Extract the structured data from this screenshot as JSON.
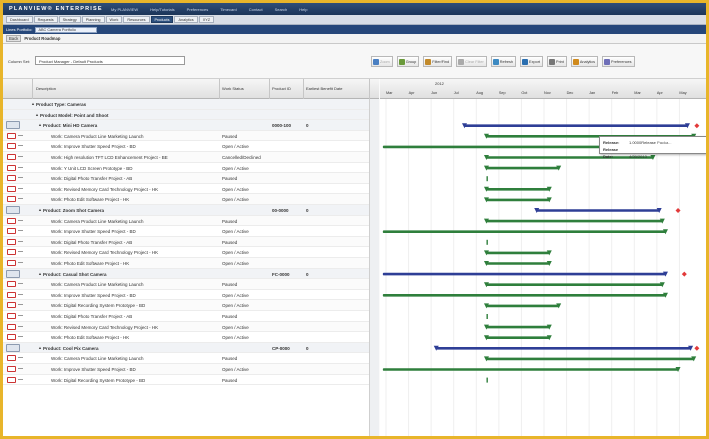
{
  "app": {
    "logo": "PLANVIEW® ENTERPRISE",
    "top_links": [
      "My PLANVIEW",
      "Help/Tutorials",
      "Preferences",
      "Timecard",
      "Contact",
      "Search",
      "Help"
    ]
  },
  "nav": [
    "Dashboard",
    "Requests",
    "Strategy",
    "Planning",
    "Work",
    "Resources",
    "Products",
    "Analytics",
    "XYZ"
  ],
  "nav_active": "Products",
  "portfolio": {
    "label": "Lines Portfolio:",
    "value": "ABC Camera Portfolio"
  },
  "breadcrumb": {
    "back": "Back",
    "title": "Product Roadmap"
  },
  "toolbar": {
    "column_set_label": "Column Set:",
    "column_set_value": "Product Manager - Default Products",
    "buttons": [
      "Zoom",
      "Group",
      "Filter/Find",
      "Clear Filter",
      "Refresh",
      "Export",
      "Print",
      "Analytics",
      "Preferences"
    ]
  },
  "grid": {
    "headers": [
      "Description",
      "Work Status",
      "Product ID",
      "Earliest Benefit Date"
    ],
    "rows": [
      {
        "type": "product-type",
        "desc": "Product Type: Cameras",
        "status": "",
        "pid": "",
        "date": ""
      },
      {
        "type": "model",
        "desc": "Product Model: Point and Shoot",
        "status": "",
        "pid": "",
        "date": ""
      },
      {
        "type": "product",
        "desc": "Product: Mini HD Camera",
        "status": "",
        "pid": "0000-100",
        "date": "0"
      },
      {
        "type": "work",
        "desc": "Work: Camera Product Line Marketing Launch",
        "status": "Paused",
        "pid": "",
        "date": ""
      },
      {
        "type": "work",
        "desc": "Work: Improve Shutter Speed Project - BD",
        "status": "Open / Active",
        "pid": "",
        "date": ""
      },
      {
        "type": "work",
        "desc": "Work: High resolution TFT LCD Enhancement Project - BE",
        "status": "Cancelled/Declined",
        "pid": "",
        "date": ""
      },
      {
        "type": "work",
        "desc": "Work: Y Unit LCD Screen Prototype - BD",
        "status": "Open / Active",
        "pid": "",
        "date": ""
      },
      {
        "type": "work",
        "desc": "Work: Digital Photo Transfer Project - AB",
        "status": "Paused",
        "pid": "",
        "date": ""
      },
      {
        "type": "work",
        "desc": "Work: Revised Memory Card Technology Project - HK",
        "status": "Open / Active",
        "pid": "",
        "date": ""
      },
      {
        "type": "work",
        "desc": "Work: Photo Edit Software Project - HK",
        "status": "Open / Active",
        "pid": "",
        "date": ""
      },
      {
        "type": "product",
        "desc": "Product: Zoom Shot Camera",
        "status": "",
        "pid": "00-0000",
        "date": "0"
      },
      {
        "type": "work",
        "desc": "Work: Camera Product Line Marketing Launch",
        "status": "Paused",
        "pid": "",
        "date": ""
      },
      {
        "type": "work",
        "desc": "Work: Improve Shutter Speed Project - BD",
        "status": "Open / Active",
        "pid": "",
        "date": ""
      },
      {
        "type": "work",
        "desc": "Work: Digital Photo Transfer Project - AB",
        "status": "Paused",
        "pid": "",
        "date": ""
      },
      {
        "type": "work",
        "desc": "Work: Revised Memory Card Technology Project - HK",
        "status": "Open / Active",
        "pid": "",
        "date": ""
      },
      {
        "type": "work",
        "desc": "Work: Photo Edit Software Project - HK",
        "status": "Open / Active",
        "pid": "",
        "date": ""
      },
      {
        "type": "product",
        "desc": "Product: Casual Shot Camera",
        "status": "",
        "pid": "FC-0000",
        "date": "0"
      },
      {
        "type": "work",
        "desc": "Work: Camera Product Line Marketing Launch",
        "status": "Paused",
        "pid": "",
        "date": ""
      },
      {
        "type": "work",
        "desc": "Work: Improve Shutter Speed Project - BD",
        "status": "Open / Active",
        "pid": "",
        "date": ""
      },
      {
        "type": "work",
        "desc": "Work: Digital Recording System Prototype - BD",
        "status": "Open / Active",
        "pid": "",
        "date": ""
      },
      {
        "type": "work",
        "desc": "Work: Digital Photo Transfer Project - AB",
        "status": "Paused",
        "pid": "",
        "date": ""
      },
      {
        "type": "work",
        "desc": "Work: Revised Memory Card Technology Project - HK",
        "status": "Open / Active",
        "pid": "",
        "date": ""
      },
      {
        "type": "work",
        "desc": "Work: Photo Edit Software Project - HK",
        "status": "Open / Active",
        "pid": "",
        "date": ""
      },
      {
        "type": "product",
        "desc": "Product: Cool Pix Camera",
        "status": "",
        "pid": "CP-0000",
        "date": "0"
      },
      {
        "type": "work",
        "desc": "Work: Camera Product Line Marketing Launch",
        "status": "Paused",
        "pid": "",
        "date": ""
      },
      {
        "type": "work",
        "desc": "Work: Improve Shutter Speed Project - BD",
        "status": "Open / Active",
        "pid": "",
        "date": ""
      },
      {
        "type": "work",
        "desc": "Work: Digital Recording System Prototype - BD",
        "status": "Paused",
        "pid": "",
        "date": ""
      }
    ]
  },
  "gantt": {
    "year": "2012",
    "months": [
      "Mar",
      "Apr",
      "Jun",
      "Jul",
      "Aug",
      "Sep",
      "Oct",
      "Nov",
      "Dec",
      "Jan",
      "Feb",
      "Mar",
      "Apr",
      "May"
    ],
    "bars": [
      null,
      null,
      {
        "s": 0.25,
        "e": 0.96,
        "c": "blue",
        "m": true
      },
      {
        "s": 0.32,
        "e": 0.98,
        "c": "green"
      },
      {
        "s": -0.01,
        "e": 0.97,
        "c": "green"
      },
      {
        "s": 0.32,
        "e": 0.85,
        "c": "green"
      },
      {
        "s": 0.32,
        "e": 0.55,
        "c": "green"
      },
      {
        "s": 0.32,
        "e": 0.33,
        "c": "green"
      },
      {
        "s": 0.32,
        "e": 0.52,
        "c": "green"
      },
      {
        "s": 0.32,
        "e": 0.52,
        "c": "green"
      },
      {
        "s": 0.48,
        "e": 0.87,
        "c": "blue",
        "m": true
      },
      {
        "s": 0.32,
        "e": 0.88,
        "c": "green"
      },
      {
        "s": -0.01,
        "e": 0.89,
        "c": "green"
      },
      {
        "s": 0.32,
        "e": 0.33,
        "c": "green"
      },
      {
        "s": 0.32,
        "e": 0.52,
        "c": "green"
      },
      {
        "s": 0.32,
        "e": 0.52,
        "c": "green"
      },
      {
        "s": -0.01,
        "e": 0.89,
        "c": "blue",
        "m": true
      },
      {
        "s": 0.32,
        "e": 0.88,
        "c": "green"
      },
      {
        "s": -0.01,
        "e": 0.89,
        "c": "green"
      },
      {
        "s": 0.32,
        "e": 0.55,
        "c": "green"
      },
      {
        "s": 0.32,
        "e": 0.33,
        "c": "green"
      },
      {
        "s": 0.32,
        "e": 0.52,
        "c": "green"
      },
      {
        "s": 0.32,
        "e": 0.52,
        "c": "green"
      },
      {
        "s": 0.16,
        "e": 0.97,
        "c": "blue",
        "m": true
      },
      {
        "s": 0.32,
        "e": 0.98,
        "c": "green"
      },
      {
        "s": -0.01,
        "e": 0.93,
        "c": "green"
      },
      {
        "s": 0.32,
        "e": 0.33,
        "c": "green"
      }
    ]
  },
  "tooltip": {
    "release_label": "Release:",
    "release_value": "1.0000Release",
    "release_date_label": "Release Date:",
    "release_date_value": "4/28/2013",
    "icon_label": "Packa..."
  },
  "colors": {
    "accent": "#2c4f7d",
    "bar_blue": "#2e3e96",
    "bar_green": "#2f7f3c",
    "milestone": "#e23a3a",
    "frame": "#e8b52a"
  }
}
